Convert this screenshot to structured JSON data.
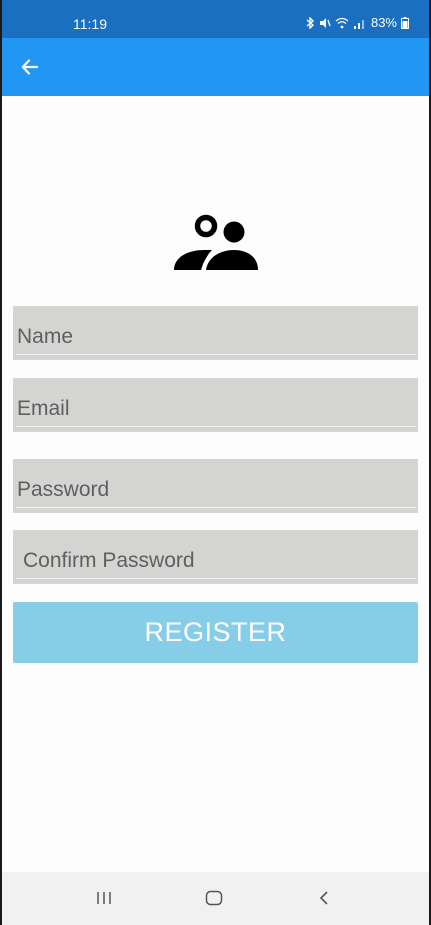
{
  "status_bar": {
    "time": "11:19",
    "battery": "83%",
    "icons": [
      "bluetooth-icon",
      "mute-icon",
      "wifi-icon",
      "signal-icon",
      "battery-icon"
    ]
  },
  "app_bar": {
    "back_icon": "arrow-left-icon",
    "color": "#2196f3"
  },
  "header": {
    "icon": "users-icon"
  },
  "form": {
    "name_placeholder": "Name",
    "email_placeholder": "Email",
    "password_placeholder": "Password",
    "confirm_placeholder": "Confirm Password",
    "name_value": "",
    "email_value": "",
    "password_value": "",
    "confirm_value": "",
    "register_label": "REGISTER",
    "register_color": "#86cee8"
  },
  "nav_bar": {
    "icons": [
      "recent-apps-icon",
      "home-icon",
      "back-icon"
    ]
  }
}
